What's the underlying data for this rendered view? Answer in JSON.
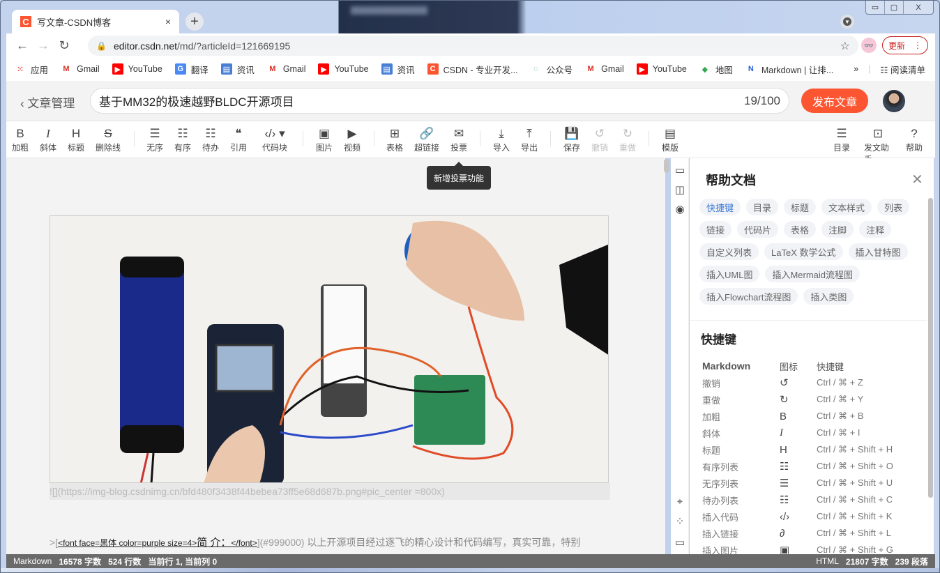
{
  "browser": {
    "tab_title": "写文章-CSDN博客",
    "tab_favicon": "C",
    "new_tab": "+",
    "close_tab": "×",
    "url_host": "editor.csdn.net",
    "url_path": "/md/?articleId=121669195",
    "update_label": "更新",
    "window_controls": [
      "minimize",
      "maximize",
      "close"
    ],
    "bookmarks": [
      {
        "label": "应用",
        "icon": "apps-icon"
      },
      {
        "label": "Gmail",
        "icon": "gmail-icon"
      },
      {
        "label": "YouTube",
        "icon": "youtube-icon"
      },
      {
        "label": "翻译",
        "icon": "translate-icon"
      },
      {
        "label": "资讯",
        "icon": "news-icon"
      },
      {
        "label": "Gmail",
        "icon": "gmail-icon"
      },
      {
        "label": "YouTube",
        "icon": "youtube-icon"
      },
      {
        "label": "资讯",
        "icon": "news-icon"
      },
      {
        "label": "CSDN - 专业开发...",
        "icon": "csdn-icon"
      },
      {
        "label": "公众号",
        "icon": "wechat-icon"
      },
      {
        "label": "Gmail",
        "icon": "gmail-icon"
      },
      {
        "label": "YouTube",
        "icon": "youtube-icon"
      },
      {
        "label": "地图",
        "icon": "maps-icon"
      },
      {
        "label": "Markdown | 让排...",
        "icon": "markdown-icon"
      }
    ],
    "overflow": "»",
    "reading_list": "阅读清单"
  },
  "header": {
    "back_label": "文章管理",
    "title": "基于MM32的极速越野BLDC开源项目",
    "title_count": "19/100",
    "publish_label": "发布文章"
  },
  "toolbar": {
    "items": [
      {
        "glyph": "B",
        "label": "加粗",
        "name": "bold"
      },
      {
        "glyph": "I",
        "label": "斜体",
        "name": "italic"
      },
      {
        "glyph": "H",
        "label": "标题",
        "name": "heading"
      },
      {
        "glyph": "S",
        "label": "删除线",
        "name": "strikethrough"
      },
      {
        "glyph": "☰",
        "label": "无序",
        "name": "unordered-list"
      },
      {
        "glyph": "☷",
        "label": "有序",
        "name": "ordered-list"
      },
      {
        "glyph": "☷",
        "label": "待办",
        "name": "todo-list"
      },
      {
        "glyph": "❝",
        "label": "引用",
        "name": "quote"
      },
      {
        "glyph": "‹/› ▾",
        "label": "代码块",
        "name": "code-block"
      },
      {
        "glyph": "▣",
        "label": "图片",
        "name": "image"
      },
      {
        "glyph": "▶",
        "label": "视频",
        "name": "video"
      },
      {
        "glyph": "⊞",
        "label": "表格",
        "name": "table"
      },
      {
        "glyph": "🔗",
        "label": "超链接",
        "name": "link"
      },
      {
        "glyph": "✉",
        "label": "投票",
        "name": "vote"
      },
      {
        "glyph": "⤓",
        "label": "导入",
        "name": "import"
      },
      {
        "glyph": "⤒",
        "label": "导出",
        "name": "export"
      },
      {
        "glyph": "💾",
        "label": "保存",
        "name": "save"
      },
      {
        "glyph": "↺",
        "label": "撤销",
        "name": "undo"
      },
      {
        "glyph": "↻",
        "label": "重做",
        "name": "redo"
      },
      {
        "glyph": "▤",
        "label": "模版",
        "name": "template"
      },
      {
        "glyph": "☰",
        "label": "目录",
        "name": "toc"
      },
      {
        "glyph": "⊡",
        "label": "发文助手",
        "name": "assistant"
      },
      {
        "glyph": "?",
        "label": "帮助",
        "name": "help"
      }
    ],
    "tooltip": "新增投票功能"
  },
  "editor": {
    "image_markdown": "![](https://img-blog.csdnimg.cn/bfd480f3438f44bebea73ff5e68d687b.png#pic_center =800x)",
    "quote_prefix": ">[",
    "quote_font_open": "<font  face=黑体 color=purple size=4>",
    "quote_font_text": "简 介：",
    "quote_font_close": "</font>",
    "quote_link": "](#999000)",
    "quote_body": " 以上开源项目经过逐飞的精心设计和代码编写，真实可靠，特别"
  },
  "help_panel": {
    "title": "帮助文档",
    "chips": [
      "快捷键",
      "目录",
      "标题",
      "文本样式",
      "列表",
      "链接",
      "代码片",
      "表格",
      "注脚",
      "注释",
      "自定义列表",
      "LaTeX 数学公式",
      "插入甘特图",
      "插入UML图",
      "插入Mermaid流程图",
      "插入Flowchart流程图",
      "插入类图"
    ],
    "active_chip": "快捷键",
    "section_title": "快捷键",
    "columns": [
      "Markdown",
      "图标",
      "快捷键"
    ],
    "rows": [
      {
        "name": "撤销",
        "icon": "↺",
        "keys": "Ctrl / ⌘ + Z"
      },
      {
        "name": "重做",
        "icon": "↻",
        "keys": "Ctrl / ⌘ + Y"
      },
      {
        "name": "加粗",
        "icon": "B",
        "keys": "Ctrl / ⌘ + B"
      },
      {
        "name": "斜体",
        "icon": "I",
        "keys": "Ctrl / ⌘ + I"
      },
      {
        "name": "标题",
        "icon": "H",
        "keys": "Ctrl / ⌘ + Shift + H"
      },
      {
        "name": "有序列表",
        "icon": "☷",
        "keys": "Ctrl / ⌘ + Shift + O"
      },
      {
        "name": "无序列表",
        "icon": "☰",
        "keys": "Ctrl / ⌘ + Shift + U"
      },
      {
        "name": "待办列表",
        "icon": "☷",
        "keys": "Ctrl / ⌘ + Shift + C"
      },
      {
        "name": "插入代码",
        "icon": "‹/›",
        "keys": "Ctrl / ⌘ + Shift + K"
      },
      {
        "name": "插入链接",
        "icon": "∂",
        "keys": "Ctrl / ⌘ + Shift + L"
      },
      {
        "name": "插入图片",
        "icon": "▣",
        "keys": "Ctrl / ⌘ + Shift + G"
      }
    ]
  },
  "statusbar": {
    "left_mode": "Markdown",
    "left_chars": "16578 字数",
    "left_lines": "524 行数",
    "left_pos": "当前行 1, 当前列 0",
    "right_mode": "HTML",
    "right_chars": "21807 字数",
    "right_paras": "239 段落"
  },
  "accent": {
    "csdn_red": "#fc5531",
    "link_blue": "#3d7ad6",
    "status_bg": "#6a6a6a"
  }
}
